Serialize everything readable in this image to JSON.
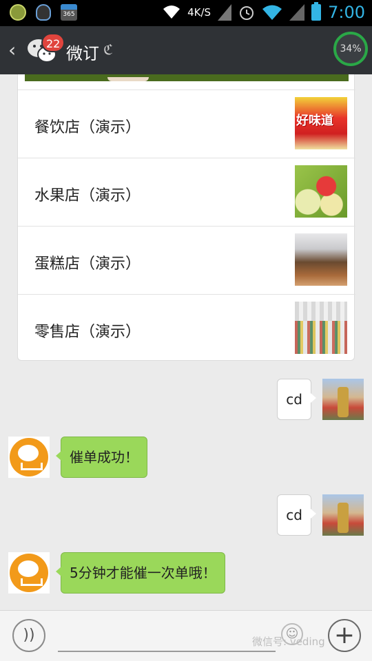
{
  "status_bar": {
    "net_speed": "4K/S",
    "time": "7:00",
    "icons": [
      "game-icon",
      "qq-icon",
      "calendar-365-icon",
      "wifi-icon",
      "signal-icon",
      "alarm-icon",
      "wifi-icon",
      "battery-icon"
    ],
    "calendar_label": "365"
  },
  "title_bar": {
    "back_icon": "‹",
    "unread_count": "22",
    "title": "微订",
    "ear_icon": "ℭ",
    "progress": "34%",
    "progress_value": 0.34,
    "accent_color": "#2aa847"
  },
  "card": {
    "items": [
      {
        "label": "餐饮店（演示）",
        "thumb_text": "好味道"
      },
      {
        "label": "水果店（演示）"
      },
      {
        "label": "蛋糕店（演示）"
      },
      {
        "label": "零售店（演示）"
      }
    ]
  },
  "messages": [
    {
      "side": "right",
      "text": "cd"
    },
    {
      "side": "left",
      "text": "催单成功！"
    },
    {
      "side": "right",
      "text": "cd"
    },
    {
      "side": "left",
      "text": "5分钟才能催一次单哦！"
    }
  ],
  "bottom_bar": {
    "voice_icon": "))",
    "emoji_icon": "☺",
    "plus_icon": "+",
    "watermark": "微信号: veding"
  },
  "colors": {
    "title_bg": "#2f3236",
    "chat_bg": "#ebebeb",
    "bubble_green": "#9ad85a",
    "badge_red": "#e0443d",
    "time_blue": "#33b5e5"
  }
}
